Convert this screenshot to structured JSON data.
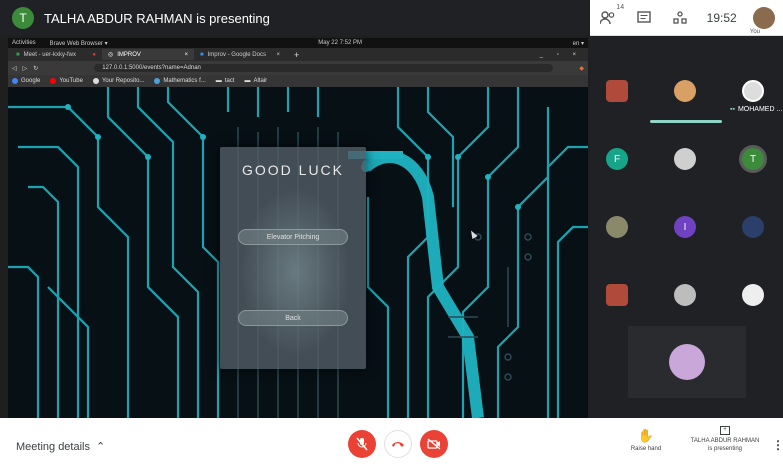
{
  "presenting": {
    "avatar_initial": "T",
    "title": "TALHA ABDUR RAHMAN is presenting"
  },
  "top_right": {
    "people_badge": "14",
    "clock": "19:52",
    "you_label": "You"
  },
  "browser": {
    "os_bar": {
      "activities": "Activities",
      "app": "Brave Web Browser ▾",
      "datetime": "May 22  7:52 PM",
      "lang": "en ▾"
    },
    "tabs": [
      {
        "label": "Meet - uer-kxky-fwx"
      },
      {
        "label": "IMPROV"
      },
      {
        "label": "Improv - Google Docs"
      }
    ],
    "url": "127.0.0.1:5000/events?name=Adnan",
    "bookmarks": [
      {
        "label": "Google",
        "color": "#4285f4"
      },
      {
        "label": "YouTube",
        "color": "#ff0000"
      },
      {
        "label": "Your Reposito...",
        "color": "#dddddd"
      },
      {
        "label": "Mathematics f...",
        "color": "#4aa3df"
      },
      {
        "label": "tact",
        "color": "#cccccc"
      },
      {
        "label": "Altair",
        "color": "#cccccc"
      }
    ]
  },
  "app_card": {
    "title": "GOOD LUCK",
    "primary_button": "Elevator Pitching",
    "back_button": "Back"
  },
  "participants": {
    "speaker_name": "MOHAMED ...",
    "tiles": [
      {
        "initial": "",
        "color": "#b04a3a"
      },
      {
        "initial": "",
        "color": "#d9a066"
      },
      {
        "initial": "",
        "color": "#dddddd"
      },
      {
        "initial": "F",
        "color": "#17a589"
      },
      {
        "initial": "",
        "color": "#cfcfcf"
      },
      {
        "initial": "T",
        "color": "#3b8b3a"
      },
      {
        "initial": "",
        "color": "#8a8a6a"
      },
      {
        "initial": "I",
        "color": "#6f42c1"
      },
      {
        "initial": "",
        "color": "#2b3f6b"
      },
      {
        "initial": "",
        "color": "#b04a3a"
      },
      {
        "initial": "",
        "color": "#bdbdbd"
      },
      {
        "initial": "",
        "color": "#eeeeee"
      }
    ]
  },
  "bottom": {
    "meeting_details": "Meeting details",
    "raise_hand": "Raise hand",
    "presenter_name": "TALHA ABDUR RAHMAN",
    "presenter_status": "is presenting"
  },
  "colors": {
    "accent_red": "#ea4335",
    "circuit_cyan": "#1fb3c2",
    "speaking_teal": "#8fd4c6"
  }
}
